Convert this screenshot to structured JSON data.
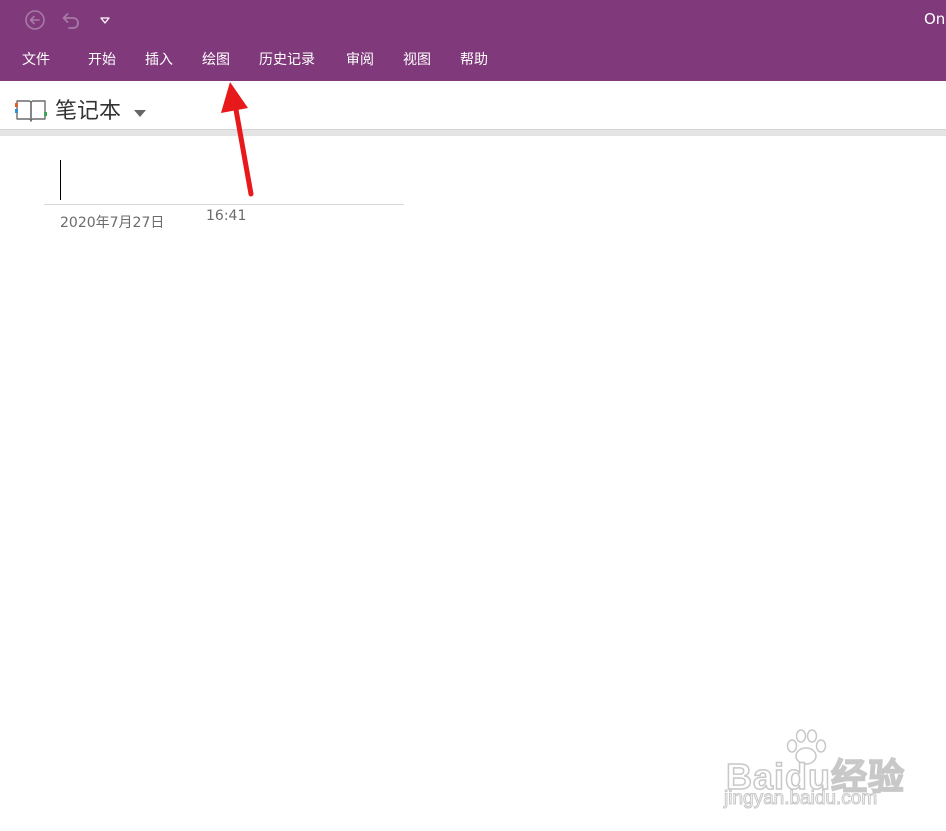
{
  "window": {
    "app_title": "OneNote",
    "accent_color": "#80397b"
  },
  "quick_access": {
    "back_icon": "back-circle-arrow-icon",
    "undo_icon": "undo-icon",
    "customize_icon": "customize-dropdown-icon"
  },
  "ribbon": {
    "tabs": [
      {
        "label": "文件"
      },
      {
        "label": "开始"
      },
      {
        "label": "插入"
      },
      {
        "label": "绘图"
      },
      {
        "label": "历史记录"
      },
      {
        "label": "审阅"
      },
      {
        "label": "视图"
      },
      {
        "label": "帮助"
      }
    ]
  },
  "notebook": {
    "name": "笔记本",
    "icon": "notebook-icon",
    "dropdown_icon": "caret-down-icon"
  },
  "page": {
    "title_value": "",
    "date": "2020年7月27日",
    "time": "16:41"
  },
  "annotation": {
    "color": "#e8191a",
    "points_to": "绘图"
  },
  "watermark": {
    "brand": "Baidu经验",
    "site": "jingyan.baidu.com"
  }
}
